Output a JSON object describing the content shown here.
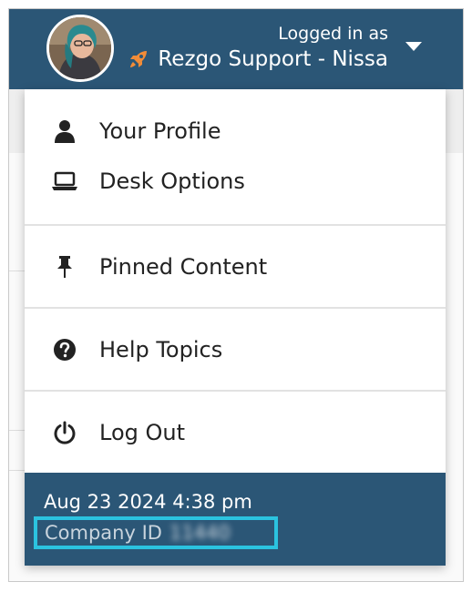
{
  "header": {
    "logged_in_label": "Logged in as",
    "user_name": "Rezgo Support - Nissa",
    "avatar": "user-avatar-photo",
    "badge_icon": "rocket-icon",
    "dropdown_icon": "caret-down-icon"
  },
  "menu": {
    "items": [
      {
        "label": "Your Profile",
        "icon": "user-icon"
      },
      {
        "label": "Desk Options",
        "icon": "laptop-icon"
      },
      {
        "label": "Pinned Content",
        "icon": "thumbtack-icon"
      },
      {
        "label": "Help Topics",
        "icon": "question-circle-icon"
      },
      {
        "label": "Log Out",
        "icon": "power-icon"
      }
    ]
  },
  "footer": {
    "datetime": "Aug 23 2024 4:38 pm",
    "company_label": "Company ID",
    "company_id": "11440"
  },
  "colors": {
    "header_bg": "#2b5676",
    "highlight": "#2bc3e0",
    "rocket": "#f28c38"
  }
}
